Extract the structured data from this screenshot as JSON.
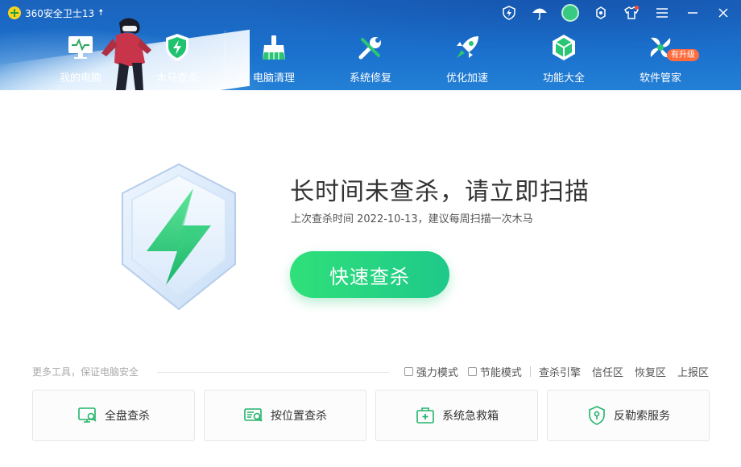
{
  "app": {
    "title": "360安全卫士13"
  },
  "nav": [
    {
      "label": "我的电脑"
    },
    {
      "label": "木马查杀"
    },
    {
      "label": "电脑清理"
    },
    {
      "label": "系统修复"
    },
    {
      "label": "优化加速"
    },
    {
      "label": "功能大全"
    },
    {
      "label": "软件管家",
      "badge": "有升级"
    }
  ],
  "window_controls": [
    "shield-icon",
    "umbrella-icon",
    "avatar",
    "settings-icon",
    "shirt-icon",
    "menu-icon",
    "minimize-icon",
    "close-icon"
  ],
  "main": {
    "headline": "长时间未查杀，请立即扫描",
    "subline": "上次查杀时间 2022-10-13，建议每周扫描一次木马",
    "scan_button": "快速查杀"
  },
  "tools": {
    "caption": "更多工具，保证电脑安全",
    "checkboxes": [
      {
        "label": "强力模式",
        "checked": false
      },
      {
        "label": "节能模式",
        "checked": false
      }
    ],
    "links": [
      "查杀引擎",
      "信任区",
      "恢复区",
      "上报区"
    ],
    "cards": [
      {
        "label": "全盘查杀",
        "icon": "monitor-search-icon"
      },
      {
        "label": "按位置查杀",
        "icon": "folder-search-icon"
      },
      {
        "label": "系统急救箱",
        "icon": "first-aid-icon"
      },
      {
        "label": "反勒索服务",
        "icon": "shield-key-icon"
      }
    ]
  },
  "colors": {
    "header": "#1a70cc",
    "accent_green": "#23d37f",
    "text": "#333333"
  }
}
